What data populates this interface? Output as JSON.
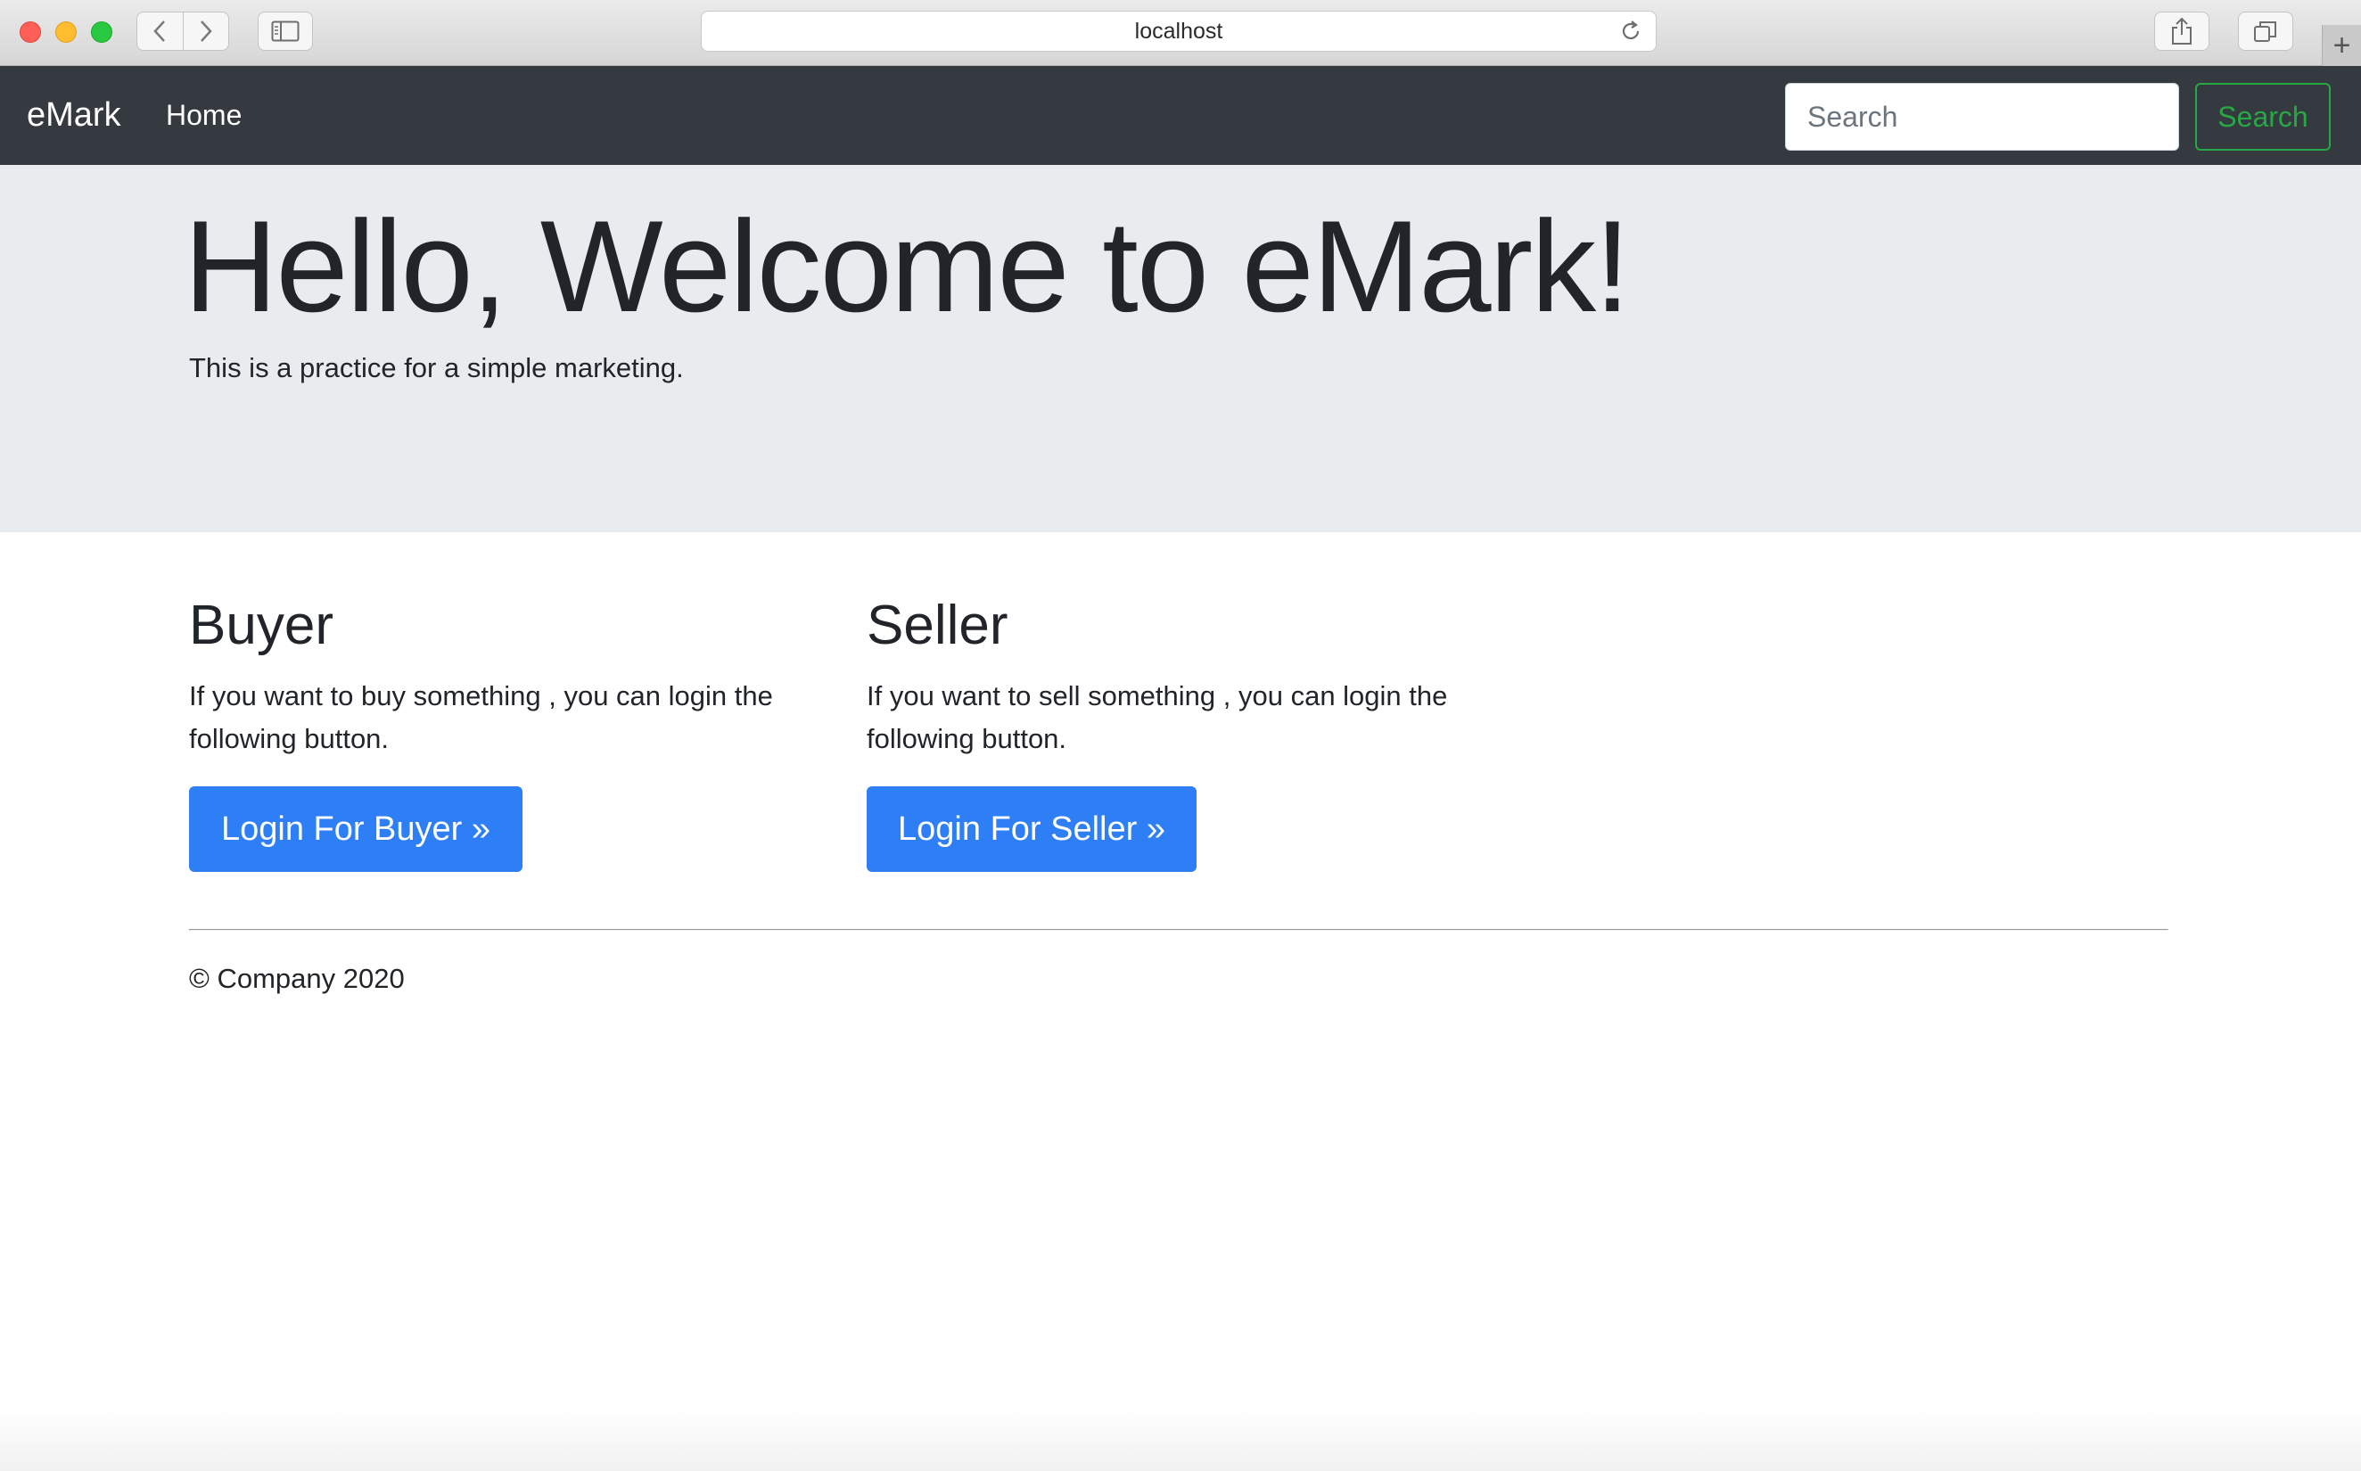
{
  "browser": {
    "url": "localhost"
  },
  "navbar": {
    "brand": "eMark",
    "home_label": "Home",
    "search_placeholder": "Search",
    "search_button": "Search"
  },
  "jumbotron": {
    "title": "Hello, Welcome to eMark!",
    "lead": "This is a practice for a simple marketing."
  },
  "buyer": {
    "heading": "Buyer",
    "text": "If you want to buy something , you can login the following button.",
    "button": "Login For Buyer »"
  },
  "seller": {
    "heading": "Seller",
    "text": "If you want to sell something , you can login the following button.",
    "button": "Login For Seller »"
  },
  "footer": {
    "copyright": "© Company 2020"
  },
  "colors": {
    "navbar_bg": "#343a40",
    "jumbotron_bg": "#e9ecef",
    "primary": "#2e7ff6",
    "success": "#28a745"
  }
}
